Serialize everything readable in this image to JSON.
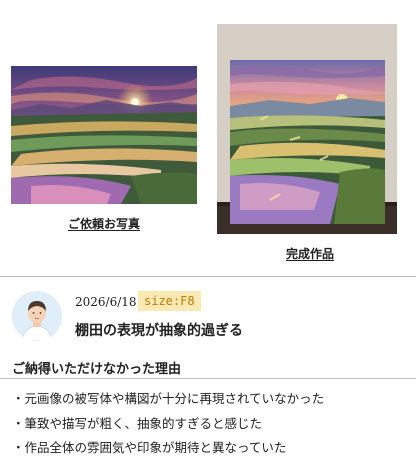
{
  "captions": {
    "photo": "ご依頼お写真",
    "work": "完成作品"
  },
  "review": {
    "date": "2026/6/18",
    "size_badge": "size:F8",
    "title": "棚田の表現が抽象的過ぎる"
  },
  "reasons": {
    "heading": "ご納得いただけなかった理由",
    "items": [
      "・元画像の被写体や構図が十分に再現されていなかった",
      "・筆致や描写が粗く、抽象的すぎると感じた",
      "・作品全体の雰囲気や印象が期待と異なっていた"
    ]
  },
  "colors": {
    "badge_bg": "#fbe9b4",
    "badge_text": "#c07a00",
    "divider": "#bdbdbd",
    "avatar_bg": "#dfeefa"
  },
  "icons": {
    "avatar": "user-avatar-icon"
  }
}
